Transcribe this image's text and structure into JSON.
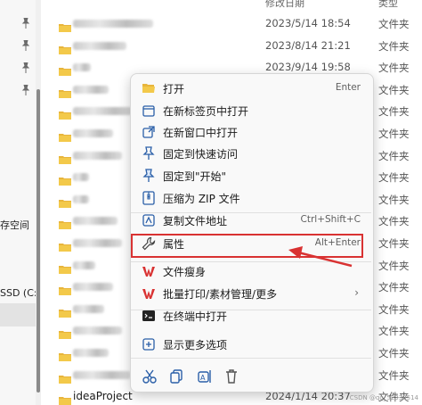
{
  "nav": {
    "labels": [
      "存空间",
      "SSD (C:)"
    ]
  },
  "file_list": {
    "header": {
      "date": "修改日期",
      "type": "类型"
    },
    "rows": [
      {
        "name": "",
        "date": "2023/5/14 18:54",
        "type": "文件夹",
        "blur_width": 90
      },
      {
        "name": "",
        "date": "2023/8/14 21:21",
        "type": "文件夹",
        "blur_width": 60
      },
      {
        "name": "",
        "date": "2023/9/14 19:58",
        "type": "文件夹",
        "blur_width": 20
      },
      {
        "name": "",
        "date": "",
        "type": "文件夹",
        "blur_width": 40
      },
      {
        "name": "",
        "date": "",
        "type": "文件夹",
        "blur_width": 70
      },
      {
        "name": "",
        "date": "",
        "type": "文件夹",
        "blur_width": 45
      },
      {
        "name": "",
        "date": "",
        "type": "文件夹",
        "blur_width": 55
      },
      {
        "name": "",
        "date": "",
        "type": "文件夹",
        "blur_width": 18
      },
      {
        "name": "",
        "date": "",
        "type": "文件夹",
        "blur_width": 18
      },
      {
        "name": "",
        "date": "",
        "type": "文件夹",
        "blur_width": 50
      },
      {
        "name": "",
        "date": "",
        "type": "文件夹",
        "blur_width": 55
      },
      {
        "name": "",
        "date": "",
        "type": "文件夹",
        "blur_width": 25
      },
      {
        "name": "",
        "date": "",
        "type": "文件夹",
        "blur_width": 45
      },
      {
        "name": "",
        "date": "",
        "type": "文件夹",
        "blur_width": 35
      },
      {
        "name": "",
        "date": "",
        "type": "文件夹",
        "blur_width": 55
      },
      {
        "name": "",
        "date": "",
        "type": "文件夹",
        "blur_width": 40
      },
      {
        "name": "",
        "date": "",
        "type": "文件夹",
        "blur_width": 65
      },
      {
        "name": "ideaProject",
        "date": "2024/1/14 20:37",
        "type": "文件夹",
        "blur_width": 0
      }
    ]
  },
  "context_menu": {
    "items": [
      {
        "icon": "folder-open-icon",
        "label": "打开",
        "shortcut": "Enter"
      },
      {
        "icon": "new-tab-icon",
        "label": "在新标签页中打开",
        "shortcut": ""
      },
      {
        "icon": "new-window-icon",
        "label": "在新窗口中打开",
        "shortcut": ""
      },
      {
        "icon": "pin-icon",
        "label": "固定到快速访问",
        "shortcut": ""
      },
      {
        "icon": "pin-start-icon",
        "label": "固定到\"开始\"",
        "shortcut": ""
      },
      {
        "icon": "zip-icon",
        "label": "压缩为 ZIP 文件",
        "shortcut": ""
      },
      {
        "icon": "copy-path-icon",
        "label": "复制文件地址",
        "shortcut": "Ctrl+Shift+C"
      },
      {
        "icon": "wrench-icon",
        "label": "属性",
        "shortcut": "Alt+Enter"
      },
      {
        "icon": "wps-icon",
        "label": "文件瘦身",
        "shortcut": ""
      },
      {
        "icon": "wps-icon",
        "label": "批量打印/素材管理/更多",
        "shortcut": "",
        "has_submenu": true
      },
      {
        "icon": "terminal-icon",
        "label": "在终端中打开",
        "shortcut": ""
      },
      {
        "icon": "more-options-icon",
        "label": "显示更多选项",
        "shortcut": ""
      }
    ],
    "bottom_actions": [
      "cut-icon",
      "copy-icon",
      "rename-icon",
      "delete-icon"
    ]
  },
  "annotation": {
    "highlight_color": "#d93232"
  },
  "watermark": "CSDN @qq_52339514"
}
